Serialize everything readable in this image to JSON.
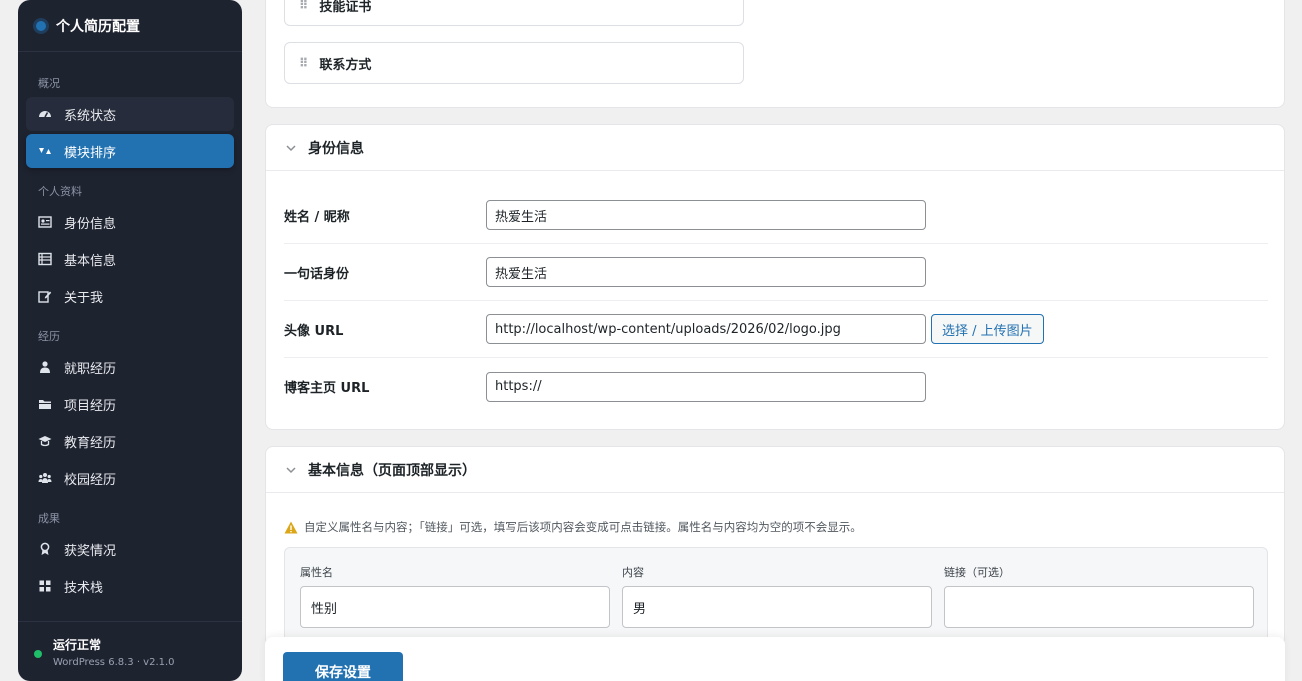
{
  "sidebar": {
    "brand_title": "个人简历配置",
    "groups": [
      {
        "label": "概况",
        "items": [
          {
            "label": "系统状态",
            "icon": "dashboard-icon"
          },
          {
            "label": "模块排序",
            "icon": "sort-icon"
          }
        ]
      },
      {
        "label": "个人资料",
        "items": [
          {
            "label": "身份信息",
            "icon": "id-card-icon"
          },
          {
            "label": "基本信息",
            "icon": "list-icon"
          },
          {
            "label": "关于我",
            "icon": "edit-icon"
          }
        ]
      },
      {
        "label": "经历",
        "items": [
          {
            "label": "就职经历",
            "icon": "user-icon"
          },
          {
            "label": "项目经历",
            "icon": "folder-icon"
          },
          {
            "label": "教育经历",
            "icon": "graduation-cap-icon"
          },
          {
            "label": "校园经历",
            "icon": "groups-icon"
          }
        ]
      },
      {
        "label": "成果",
        "items": [
          {
            "label": "获奖情况",
            "icon": "award-icon"
          },
          {
            "label": "技术栈",
            "icon": "grid-icon"
          }
        ]
      }
    ],
    "footer": {
      "status": "运行正常",
      "version": "WordPress 6.8.3 · v2.1.0"
    }
  },
  "modules": {
    "items": [
      "技能证书",
      "联系方式"
    ]
  },
  "identity": {
    "title": "身份信息",
    "rows": [
      {
        "label": "姓名 / 昵称",
        "value": "热爱生活"
      },
      {
        "label": "一句话身份",
        "value": "热爱生活"
      },
      {
        "label": "头像 URL",
        "value": "http://localhost/wp-content/uploads/2026/02/logo.jpg",
        "button": "选择 / 上传图片"
      },
      {
        "label": "博客主页 URL",
        "value": "https://"
      }
    ]
  },
  "basic": {
    "title": "基本信息（页面顶部显示）",
    "notice": "自定义属性名与内容；「链接」可选，填写后该项内容会变成可点击链接。属性名与内容均为空的项不会显示。",
    "columns": [
      "属性名",
      "内容",
      "链接（可选）"
    ],
    "row": [
      "性别",
      "男",
      ""
    ]
  },
  "save_label": "保存设置",
  "colors": {
    "accent": "#2271b1",
    "sidebar_bg": "#1e2330",
    "status_ok": "#1fbf6a",
    "warning": "#dba617"
  }
}
